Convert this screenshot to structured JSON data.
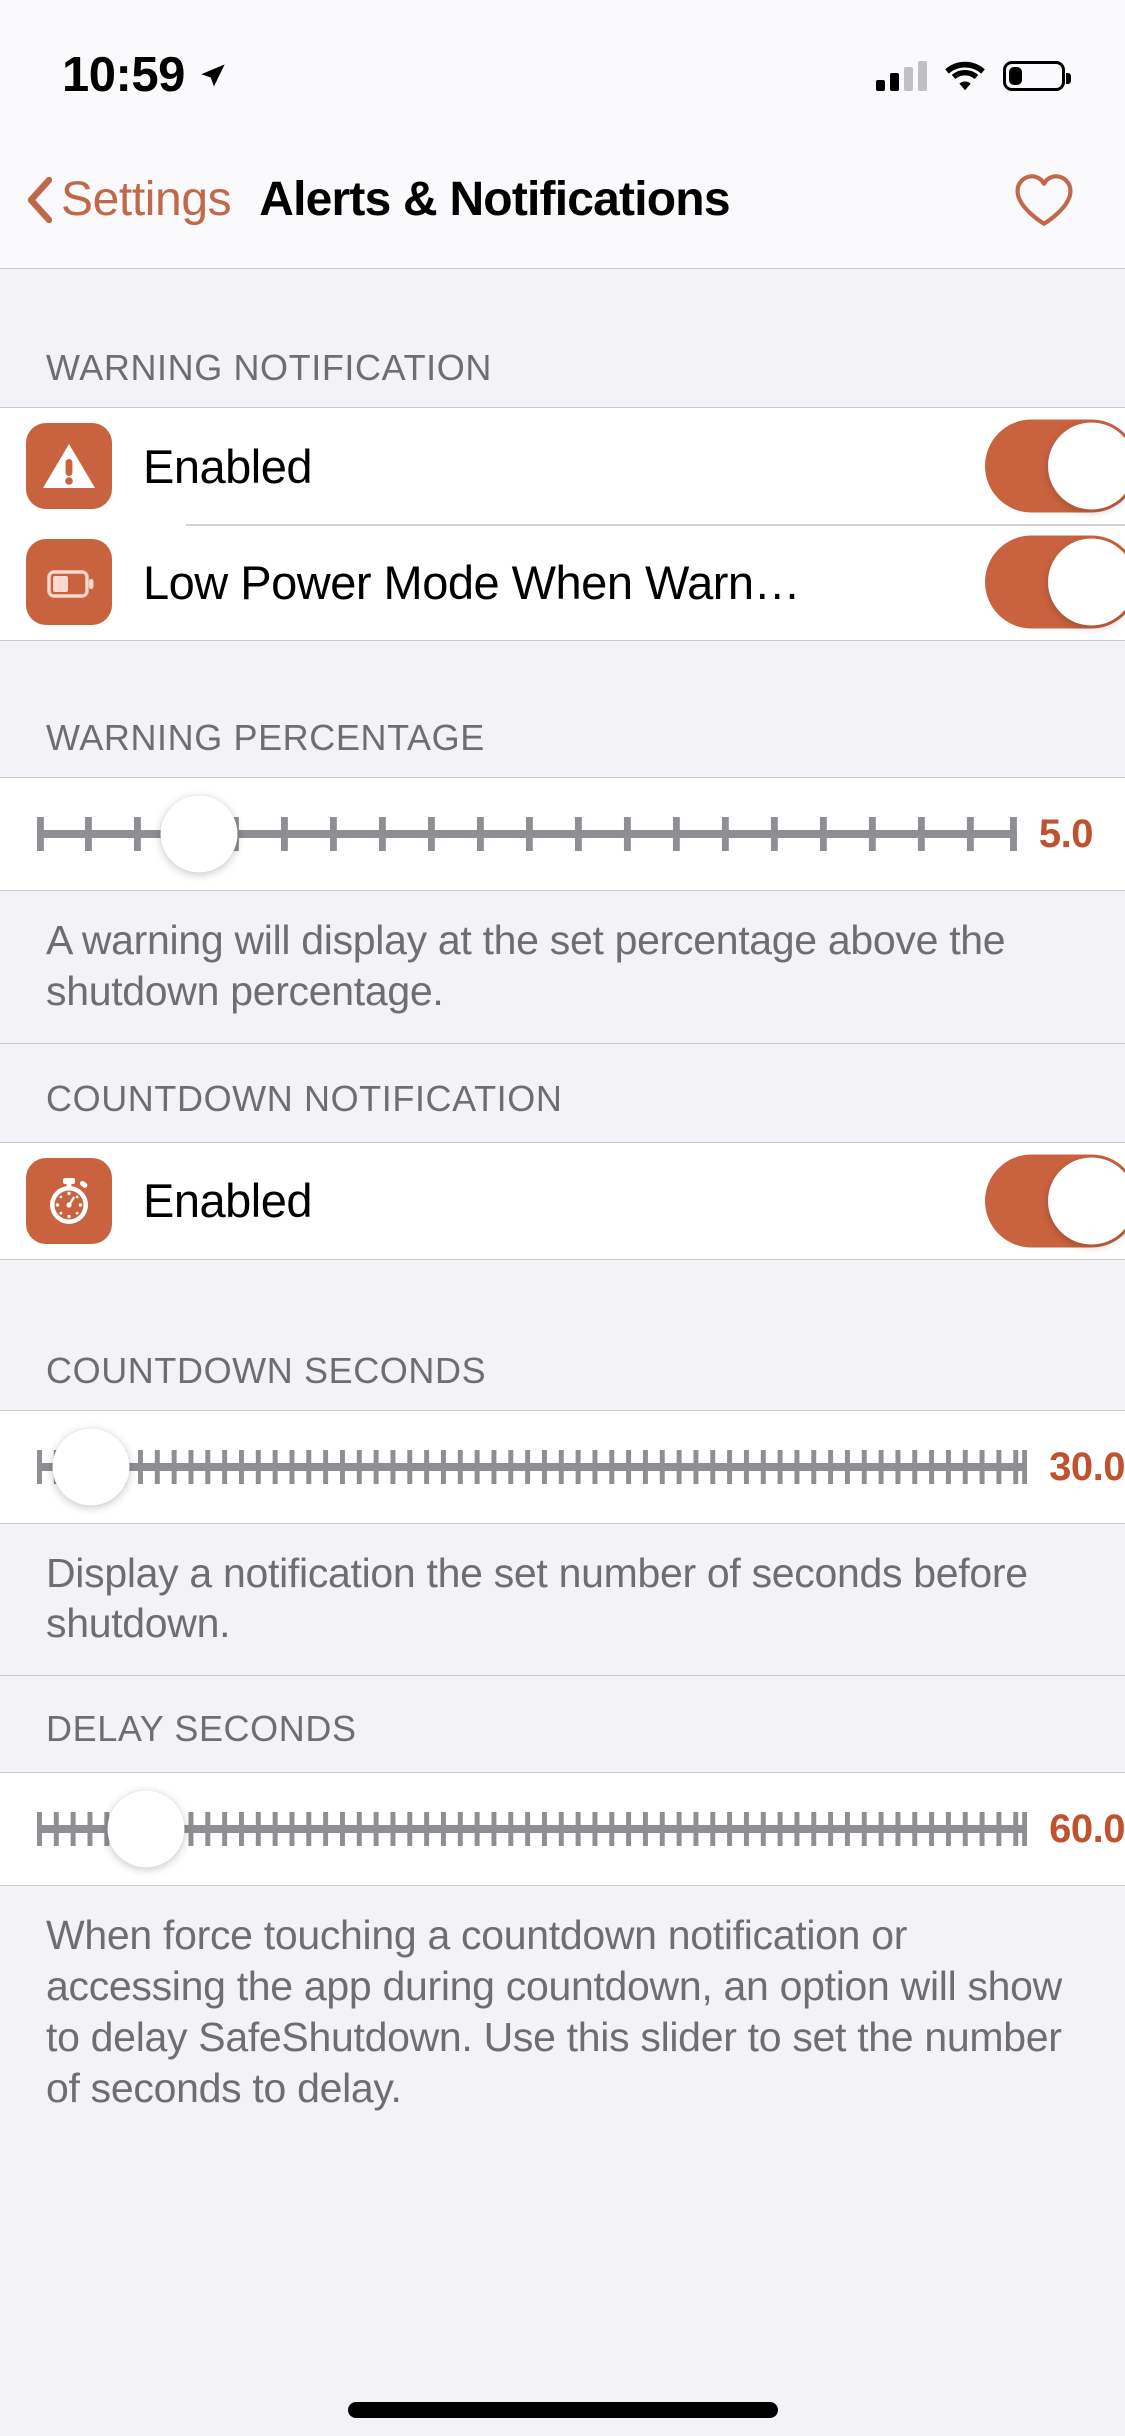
{
  "status_bar": {
    "time": "10:59",
    "location_icon": "location-arrow-icon",
    "signal_icon": "cellular-signal-icon",
    "signal_bars_filled": 2,
    "wifi_icon": "wifi-icon",
    "battery_icon": "battery-icon",
    "battery_percent": 26
  },
  "nav": {
    "back_label": "Settings",
    "back_icon": "chevron-left-icon",
    "title": "Alerts & Notifications",
    "favorite_icon": "heart-outline-icon"
  },
  "colors": {
    "accent": "#C8623F",
    "accent_text": "#C1684B",
    "value_text": "#C1522F",
    "group_header_text": "#6D6D72",
    "background": "#F2F2F7",
    "cell_background": "#FFFFFF",
    "track": "#8E8E93"
  },
  "sections": [
    {
      "header": "WARNING NOTIFICATION",
      "rows": [
        {
          "icon": "warning-triangle-icon",
          "label": "Enabled",
          "toggle": "on"
        },
        {
          "icon": "battery-low-icon",
          "label": "Low Power Mode When Warn…",
          "toggle": "on"
        }
      ]
    },
    {
      "header": "WARNING PERCENTAGE",
      "slider": {
        "value_label": "5.0",
        "value": 5.0,
        "position_pct": 11,
        "tick_count": 21
      },
      "footnote": "A warning will display at the set percentage above the shutdown percentage."
    },
    {
      "header": "COUNTDOWN NOTIFICATION",
      "rows": [
        {
          "icon": "stopwatch-icon",
          "label": "Enabled",
          "toggle": "on"
        }
      ]
    },
    {
      "header": "COUNTDOWN SECONDS",
      "slider": {
        "value_label": "30.0",
        "value": 30.0,
        "position_pct": 4,
        "tick_count": 60
      },
      "footnote": "Display a notification the set number of seconds before shutdown."
    },
    {
      "header": "DELAY SECONDS",
      "slider": {
        "value_label": "60.0",
        "value": 60.0,
        "position_pct": 9,
        "tick_count": 60
      },
      "footnote": "When force touching a countdown notification or accessing the app during countdown, an option will show to delay SafeShutdown. Use this slider to set the number of seconds to delay."
    }
  ],
  "home_indicator": "home-indicator"
}
